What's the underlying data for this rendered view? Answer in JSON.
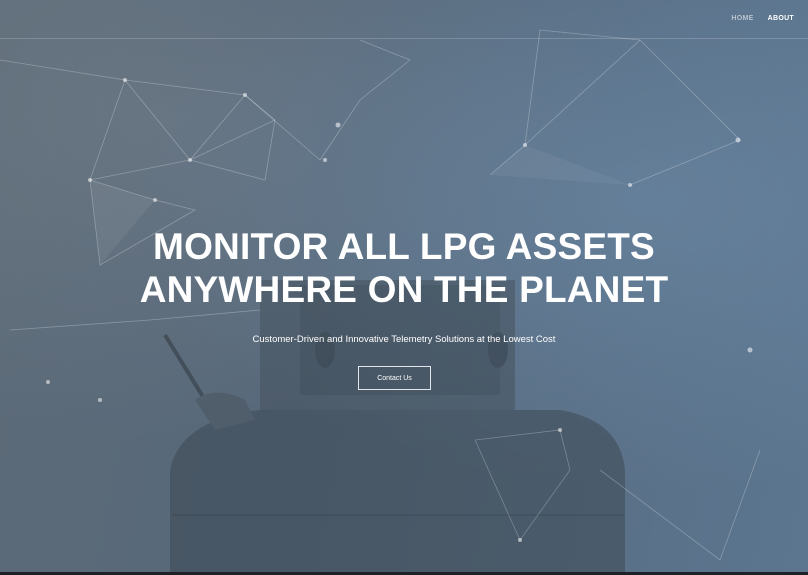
{
  "nav": {
    "items": [
      {
        "label": "HOME",
        "active": false
      },
      {
        "label": "ABOUT",
        "active": true
      }
    ]
  },
  "hero": {
    "title_line1": "MONITOR ALL LPG ASSETS",
    "title_line2": "ANYWHERE ON THE PLANET",
    "subtitle": "Customer-Driven and Innovative Telemetry Solutions at the Lowest Cost",
    "cta_label": "Contact Us"
  },
  "colors": {
    "overlay": "#56687a",
    "accent_right": "#5c7690",
    "text": "#ffffff"
  }
}
